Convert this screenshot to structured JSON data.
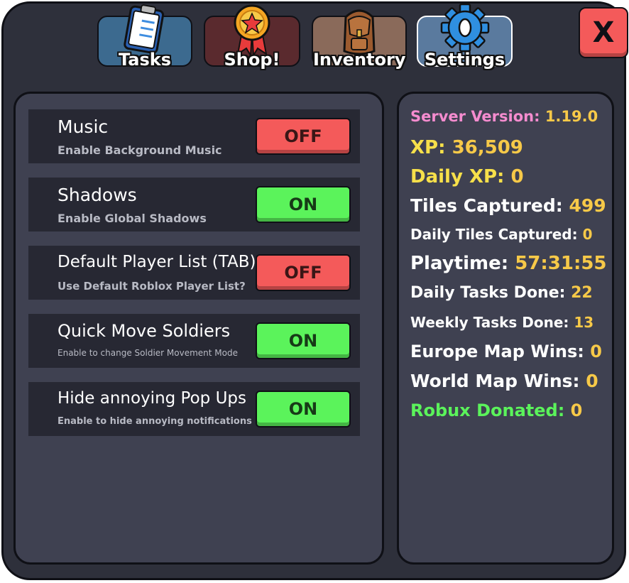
{
  "tabs": [
    {
      "label": "Tasks",
      "icon": "clipboard-icon"
    },
    {
      "label": "Shop!",
      "icon": "ribbon-badge-icon"
    },
    {
      "label": "Inventory",
      "icon": "backpack-icon"
    },
    {
      "label": "Settings",
      "icon": "gear-icon"
    }
  ],
  "close_label": "X",
  "settings": [
    {
      "title": "Music",
      "desc": "Enable Background Music",
      "state": "OFF"
    },
    {
      "title": "Shadows",
      "desc": "Enable Global Shadows",
      "state": "ON"
    },
    {
      "title": "Default Player List (TAB)",
      "desc": "Use Default Roblox Player List?",
      "state": "OFF"
    },
    {
      "title": "Quick Move Soldiers",
      "desc": "Enable to change Soldier Movement Mode",
      "state": "ON"
    },
    {
      "title": "Hide annoying Pop Ups",
      "desc": "Enable to hide annoying notifications",
      "state": "ON"
    }
  ],
  "stats": [
    {
      "label": "Server Version: ",
      "value": "1.19.0",
      "label_color": "#f58ccf"
    },
    {
      "label": "XP: ",
      "value": "36,509",
      "label_color": "#f7e04a"
    },
    {
      "label": "Daily XP: ",
      "value": "0",
      "label_color": "#f7e04a"
    },
    {
      "label": "Tiles Captured: ",
      "value": "499",
      "label_color": "#ffffff"
    },
    {
      "label": "Daily Tiles Captured: ",
      "value": "0",
      "label_color": "#ffffff"
    },
    {
      "label": "Playtime: ",
      "value": "57:31:55",
      "label_color": "#ffffff"
    },
    {
      "label": "Daily Tasks Done: ",
      "value": "22",
      "label_color": "#ffffff"
    },
    {
      "label": "Weekly Tasks Done: ",
      "value": "13",
      "label_color": "#ffffff"
    },
    {
      "label": "Europe Map Wins: ",
      "value": "0",
      "label_color": "#ffffff"
    },
    {
      "label": "World Map Wins: ",
      "value": "0",
      "label_color": "#ffffff"
    },
    {
      "label": "Robux Donated: ",
      "value": "0",
      "label_color": "#5bf35b"
    }
  ],
  "colors": {
    "on": "#5bf35b",
    "off": "#f45a5a",
    "value": "#f7c948"
  }
}
